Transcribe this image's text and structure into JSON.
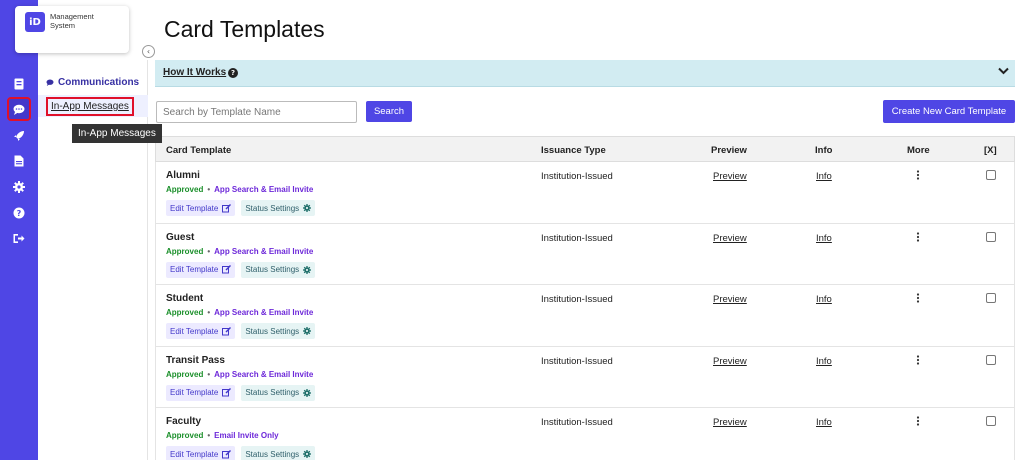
{
  "colors": {
    "accent": "#4f46e5",
    "approved": "#1a8f2a",
    "method": "#6d28d9",
    "highlight": "#e0102a"
  },
  "logo": {
    "mark": "iD",
    "line1": "Management",
    "line2": "System"
  },
  "rail_icons": [
    "id-card-icon",
    "chat-icon",
    "rocket-icon",
    "document-icon",
    "gear-icon",
    "help-icon",
    "logout-icon"
  ],
  "sidebar": {
    "section": "Communications",
    "item": "In-App Messages"
  },
  "tooltip": "In-App Messages",
  "page": {
    "title": "Card Templates"
  },
  "how_it_works": "How It Works",
  "search": {
    "placeholder": "Search by Template Name",
    "value": "",
    "button": "Search"
  },
  "create_button": "Create New Card Template",
  "table": {
    "headers": {
      "template": "Card Template",
      "issuance": "Issuance Type",
      "preview": "Preview",
      "info": "Info",
      "more": "More",
      "select": "[X]"
    },
    "edit_label": "Edit Template",
    "status_label": "Status Settings",
    "rows": [
      {
        "name": "Alumni",
        "status": "Approved",
        "method": "App Search & Email Invite",
        "issuance": "Institution-Issued",
        "preview": "Preview",
        "info": "Info"
      },
      {
        "name": "Guest",
        "status": "Approved",
        "method": "App Search & Email Invite",
        "issuance": "Institution-Issued",
        "preview": "Preview",
        "info": "Info"
      },
      {
        "name": "Student",
        "status": "Approved",
        "method": "App Search & Email Invite",
        "issuance": "Institution-Issued",
        "preview": "Preview",
        "info": "Info"
      },
      {
        "name": "Transit Pass",
        "status": "Approved",
        "method": "App Search & Email Invite",
        "issuance": "Institution-Issued",
        "preview": "Preview",
        "info": "Info"
      },
      {
        "name": "Faculty",
        "status": "Approved",
        "method": "Email Invite Only",
        "issuance": "Institution-Issued",
        "preview": "Preview",
        "info": "Info"
      }
    ]
  }
}
